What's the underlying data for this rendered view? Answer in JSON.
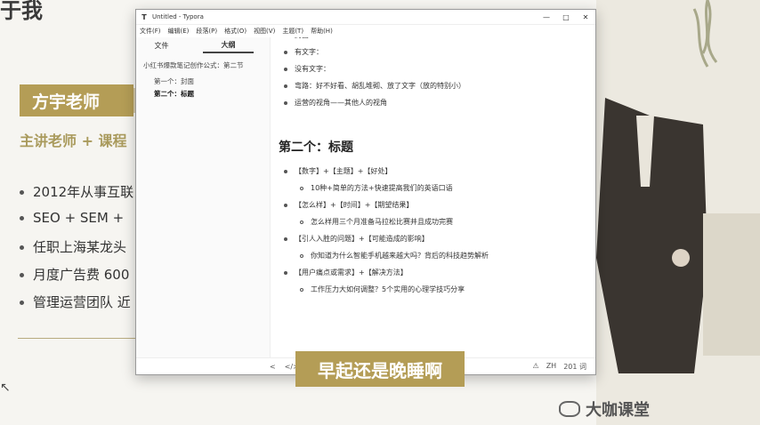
{
  "slide": {
    "title": "于我",
    "teacher_badge": "方宇老师",
    "subtitle": "主讲老师 + 课程",
    "bullets": [
      "2012年从事互联",
      "SEO + SEM +",
      "任职上海某龙头",
      "月度广告费 600",
      "管理运营团队 近"
    ]
  },
  "window": {
    "title": "Untitled - Typora",
    "menus": [
      "文件(F)",
      "编辑(E)",
      "段落(P)",
      "格式(O)",
      "视图(V)",
      "主题(T)",
      "帮助(H)"
    ],
    "controls": [
      "—",
      "□",
      "✕"
    ]
  },
  "sidebar": {
    "tabs": [
      "文件",
      "大纲"
    ],
    "outline_title": "小红书爆款笔记创作公式：第二节",
    "outline_items": [
      "第一个：封面",
      "第二个：标题"
    ]
  },
  "editor": {
    "top_items": [
      "封面",
      "有文字：",
      "没有文字：",
      "弯路：好不好看、胡乱堆砌、放了文字（放的特别小）",
      "运营的视角——其他人的视角"
    ],
    "heading": "第二个：标题",
    "groups": [
      {
        "title": "【数字】+【主题】+【好处】",
        "example": "10种+简单的方法+快速提高我们的英语口语"
      },
      {
        "title": "【怎么样】+【时间】+【期望结果】",
        "example": "怎么样用三个月准备马拉松比赛并且成功完赛"
      },
      {
        "title": "【引人入胜的问题】+【可能造成的影响】",
        "example": "你知道为什么智能手机越来越大吗？背后的科技趋势解析"
      },
      {
        "title": "【用户痛点或需求】+【解决方法】",
        "example": "工作压力大如何调整？5个实用的心理学技巧分享"
      }
    ]
  },
  "statusbar": {
    "left": [
      "<",
      "</>"
    ],
    "right": [
      "⚠",
      "ZH",
      "201 词"
    ]
  },
  "caption": "早起还是晚睡啊",
  "logo": "大咖课堂"
}
